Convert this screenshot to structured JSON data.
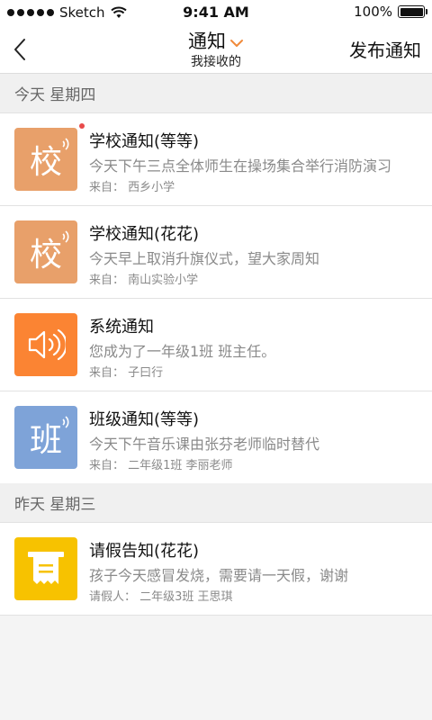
{
  "status_bar": {
    "carrier": "Sketch",
    "time": "9:41 AM",
    "battery_percent": "100%",
    "battery_level": 1.0
  },
  "nav": {
    "title": "通知",
    "subtitle": "我接收的",
    "publish_label": "发布通知",
    "accent_color": "#f08a3a"
  },
  "sections": [
    {
      "header": "今天 星期四",
      "items": [
        {
          "title": "学校通知(等等)",
          "body": "今天下午三点全体师生在操场集合举行消防演习",
          "from": "来自： 西乡小学",
          "icon": "school-notice-icon",
          "icon_char": "校",
          "icon_color": "#e8a06a",
          "unread": true
        },
        {
          "title": "学校通知(花花)",
          "body": "今天早上取消升旗仪式，望大家周知",
          "from": "来自： 南山实验小学",
          "icon": "school-notice-icon",
          "icon_char": "校",
          "icon_color": "#e8a06a",
          "unread": false
        },
        {
          "title": "系统通知",
          "body": "您成为了一年级1班 班主任。",
          "from": "来自： 子曰行",
          "icon": "speaker-icon",
          "icon_char": "",
          "icon_color": "#fb8433",
          "unread": false
        },
        {
          "title": "班级通知(等等)",
          "body": "今天下午音乐课由张芬老师临时替代",
          "from": "来自： 二年级1班 李丽老师",
          "icon": "class-notice-icon",
          "icon_char": "班",
          "icon_color": "#7ea3d8",
          "unread": false
        }
      ]
    },
    {
      "header": "昨天 星期三",
      "items": [
        {
          "title": "请假告知(花花)",
          "body": "孩子今天感冒发烧，需要请一天假，谢谢",
          "from": "请假人： 二年级3班 王思琪",
          "icon": "leave-request-icon",
          "icon_char": "",
          "icon_color": "#f7c200",
          "unread": false
        }
      ]
    }
  ]
}
